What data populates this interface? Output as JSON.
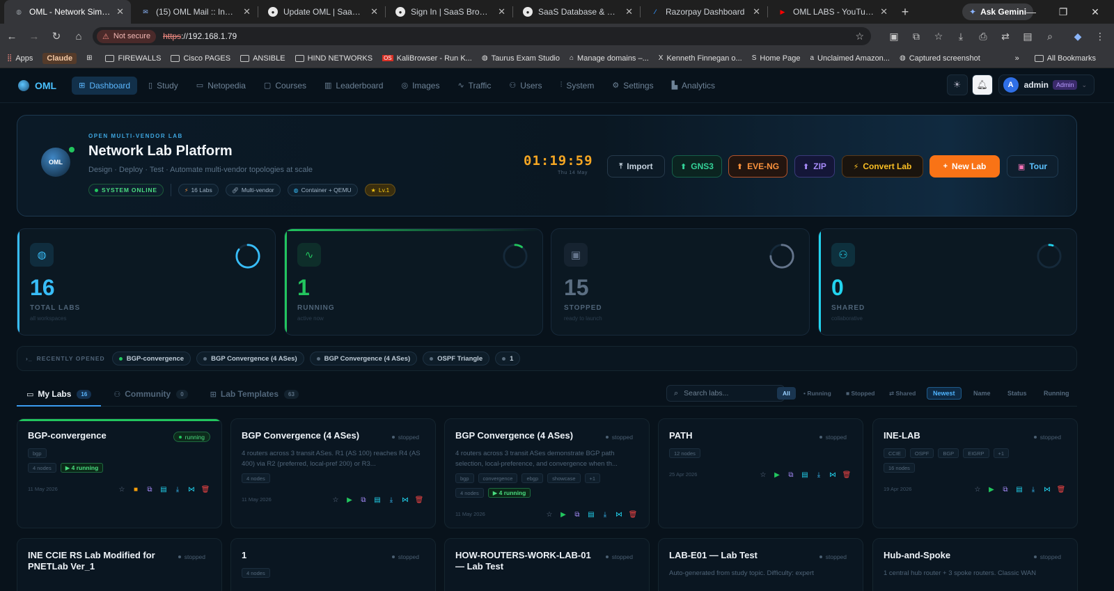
{
  "browser": {
    "tabs": [
      {
        "title": "OML - Network Simulator",
        "active": true,
        "favicon": "globe-icon",
        "color": "#9aa0a6"
      },
      {
        "title": "(15) OML Mail :: Inbox",
        "active": false,
        "favicon": "mail-icon",
        "color": "#8ab4f8"
      },
      {
        "title": "Update OML | SaaS Browser",
        "active": false,
        "favicon": "github-icon",
        "color": "#222"
      },
      {
        "title": "Sign In | SaaS Browser",
        "active": false,
        "favicon": "github-icon",
        "color": "#222"
      },
      {
        "title": "SaaS Database & Software S",
        "active": false,
        "favicon": "github-icon",
        "color": "#222"
      },
      {
        "title": "Razorpay Dashboard",
        "active": false,
        "favicon": "razorpay-icon",
        "color": "#3395ff"
      },
      {
        "title": "OML LABS - YouTube",
        "active": false,
        "favicon": "youtube-icon",
        "color": "#ff0000"
      }
    ],
    "ask_gemini": "Ask Gemini",
    "not_secure": "Not secure",
    "url_scheme": "https",
    "url_rest": "://192.168.1.79",
    "bookmarks": [
      {
        "label": "Apps",
        "icon": "apps-grid-icon"
      },
      {
        "label": "Claude",
        "icon": "claude-icon"
      },
      {
        "label": "",
        "icon": "grid-icon"
      },
      {
        "label": "FIREWALLS",
        "icon": "folder-icon"
      },
      {
        "label": "Cisco PAGES",
        "icon": "folder-icon"
      },
      {
        "label": "ANSIBLE",
        "icon": "folder-icon"
      },
      {
        "label": "HIND NETWORKS",
        "icon": "folder-icon"
      },
      {
        "label": "KaliBrowser - Run K...",
        "icon": "os-icon"
      },
      {
        "label": "Taurus Exam Studio",
        "icon": "globe-icon"
      },
      {
        "label": "Manage domains –...",
        "icon": "domain-icon"
      },
      {
        "label": "Kenneth Finnegan o...",
        "icon": "x-icon"
      },
      {
        "label": "Home Page",
        "icon": "s-icon"
      },
      {
        "label": "Unclaimed Amazon...",
        "icon": "a-icon"
      },
      {
        "label": "Captured screenshot",
        "icon": "globe-icon"
      }
    ],
    "all_bookmarks": "All Bookmarks"
  },
  "app": {
    "logo": "OML",
    "nav": [
      {
        "label": "Dashboard",
        "icon": "grid-icon",
        "active": true
      },
      {
        "label": "Study",
        "icon": "book-icon",
        "active": false
      },
      {
        "label": "Netopedia",
        "icon": "book-open-icon",
        "active": false
      },
      {
        "label": "Courses",
        "icon": "layers-icon",
        "active": false
      },
      {
        "label": "Leaderboard",
        "icon": "bar-chart-icon",
        "active": false
      },
      {
        "label": "Images",
        "icon": "disc-icon",
        "active": false
      },
      {
        "label": "Traffic",
        "icon": "activity-icon",
        "active": false
      },
      {
        "label": "Users",
        "icon": "users-icon",
        "active": false
      },
      {
        "label": "System",
        "icon": "bars-icon",
        "active": false
      },
      {
        "label": "Settings",
        "icon": "gear-icon",
        "active": false
      },
      {
        "label": "Analytics",
        "icon": "chart-icon",
        "active": false
      }
    ],
    "user": {
      "initial": "A",
      "name": "admin",
      "role": "Admin"
    }
  },
  "hero": {
    "eyebrow": "OPEN MULTI-VENDOR LAB",
    "title": "Network Lab Platform",
    "subtitle": "Design · Deploy · Test · Automate multi-vendor topologies at scale",
    "status": "SYSTEM ONLINE",
    "pills": [
      {
        "label": "16 Labs",
        "icon": "bolt-icon"
      },
      {
        "label": "Multi-vendor",
        "icon": "link-icon"
      },
      {
        "label": "Container + QEMU",
        "icon": "globe-icon"
      },
      {
        "label": "Lv.1",
        "icon": "star-icon"
      }
    ],
    "clock": "01:19:59",
    "date": "Thu 14 May",
    "buttons": {
      "import": "Import",
      "gns3": "GNS3",
      "eve": "EVE-NG",
      "zip": "ZIP",
      "convert": "Convert Lab",
      "new_lab": "New Lab",
      "tour": "Tour"
    }
  },
  "stats": [
    {
      "value": "16",
      "label": "TOTAL LABS",
      "sub": "all workspaces",
      "icon": "globe-icon",
      "color": "#38bdf8",
      "ring": 0.85
    },
    {
      "value": "1",
      "label": "RUNNING",
      "sub": "active now",
      "icon": "activity-icon",
      "color": "#22c55e",
      "ring": 0.1
    },
    {
      "value": "15",
      "label": "STOPPED",
      "sub": "ready to launch",
      "icon": "cpu-icon",
      "color": "#64748b",
      "ring": 0.75
    },
    {
      "value": "0",
      "label": "SHARED",
      "sub": "collaborative",
      "icon": "users-icon",
      "color": "#22d3ee",
      "ring": 0.05
    }
  ],
  "recent": {
    "label": "RECENTLY OPENED",
    "items": [
      {
        "label": "BGP-convergence",
        "running": true
      },
      {
        "label": "BGP Convergence (4 ASes)",
        "running": false
      },
      {
        "label": "BGP Convergence (4 ASes)",
        "running": false
      },
      {
        "label": "OSPF Triangle",
        "running": false
      },
      {
        "label": "1",
        "running": false
      }
    ]
  },
  "lab_tabs": [
    {
      "label": "My Labs",
      "count": "16",
      "icon": "folder-icon",
      "active": true
    },
    {
      "label": "Community",
      "count": "0",
      "icon": "users-icon",
      "active": false
    },
    {
      "label": "Lab Templates",
      "count": "63",
      "icon": "grid-icon",
      "active": false
    }
  ],
  "search": {
    "placeholder": "Search labs..."
  },
  "filters": [
    "All",
    "• Running",
    "■ Stopped",
    "⇄ Shared"
  ],
  "sorts": [
    "Newest",
    "Name",
    "Status",
    "Running"
  ],
  "cards": [
    {
      "title": "BGP-convergence",
      "status": "running",
      "desc": "",
      "tags": [
        "bgp"
      ],
      "meta": [
        "4 nodes",
        "▶ 4 running"
      ],
      "date": "11 May 2026"
    },
    {
      "title": "BGP Convergence (4 ASes)",
      "status": "stopped",
      "desc": "4 routers across 3 transit ASes. R1 (AS 100) reaches R4 (AS 400) via R2 (preferred, local-pref 200) or R3...",
      "tags": [],
      "meta": [
        "4 nodes"
      ],
      "date": "11 May 2026"
    },
    {
      "title": "BGP Convergence (4 ASes)",
      "status": "stopped",
      "desc": "4 routers across 3 transit ASes demonstrate BGP path selection, local-preference, and convergence when th...",
      "tags": [
        "bgp",
        "convergence",
        "ebgp",
        "showcase",
        "+1"
      ],
      "meta": [
        "4 nodes",
        "▶ 4 running"
      ],
      "date": "11 May 2026"
    },
    {
      "title": "PATH",
      "status": "stopped",
      "desc": "",
      "tags": [],
      "meta": [
        "12 nodes"
      ],
      "date": "25 Apr 2026"
    },
    {
      "title": "INE-LAB",
      "status": "stopped",
      "desc": "",
      "tags": [
        "CCIE",
        "OSPF",
        "BGP",
        "EIGRP",
        "+1"
      ],
      "meta": [
        "16 nodes"
      ],
      "date": "19 Apr 2026"
    },
    {
      "title": "INE CCIE RS Lab Modified for PNETLab Ver_1",
      "status": "stopped",
      "desc": "",
      "tags": [],
      "meta": [],
      "date": ""
    },
    {
      "title": "1",
      "status": "stopped",
      "desc": "",
      "tags": [],
      "meta": [
        "4 nodes"
      ],
      "date": ""
    },
    {
      "title": "HOW-ROUTERS-WORK-LAB-01 — Lab Test",
      "status": "stopped",
      "desc": "",
      "tags": [],
      "meta": [],
      "date": ""
    },
    {
      "title": "LAB-E01 — Lab Test",
      "status": "stopped",
      "desc": "Auto-generated from study topic. Difficulty: expert",
      "tags": [],
      "meta": [],
      "date": ""
    },
    {
      "title": "Hub-and-Spoke",
      "status": "stopped",
      "desc": "1 central hub router + 3 spoke routers. Classic WAN",
      "tags": [],
      "meta": [],
      "date": ""
    }
  ]
}
